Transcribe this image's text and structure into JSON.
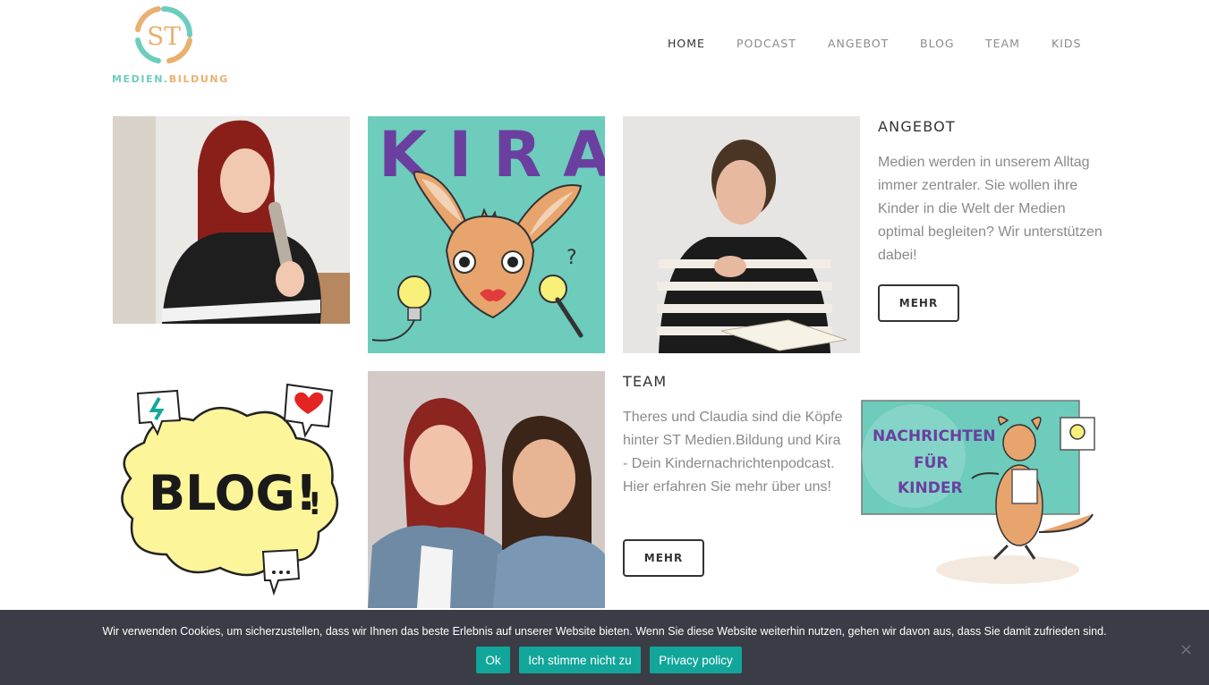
{
  "logo": {
    "monogram": "ST",
    "brand_part1": "MEDIEN.",
    "brand_part2": "BILDUNG",
    "colors": {
      "teal": "#6ccdbd",
      "orange": "#e9b06f"
    }
  },
  "nav": {
    "items": [
      {
        "label": "HOME",
        "active": true
      },
      {
        "label": "PODCAST",
        "active": false
      },
      {
        "label": "ANGEBOT",
        "active": false
      },
      {
        "label": "BLOG",
        "active": false
      },
      {
        "label": "TEAM",
        "active": false
      },
      {
        "label": "KIDS",
        "active": false
      }
    ]
  },
  "tiles": {
    "kira_title": "KIRA",
    "blog_text": "BLOG!",
    "blog_exclaim": "!",
    "kids_line1": "NACHRICHTEN",
    "kids_line2": "FÜR",
    "kids_line3": "KINDER"
  },
  "angebot": {
    "heading": "ANGEBOT",
    "text": "Medien werden in unserem Alltag immer zentraler. Sie wollen ihre Kinder in die Welt der Medien optimal begleiten? Wir unterstützen dabei!",
    "button": "MEHR"
  },
  "team": {
    "heading": "TEAM",
    "text": "Theres und Claudia sind die Köpfe hinter ST Medien.Bildung und Kira - Dein Kindernachrichtenpodcast. Hier erfahren Sie mehr über uns!",
    "button": "MEHR"
  },
  "cookie": {
    "message": "Wir verwenden Cookies, um sicherzustellen, dass wir Ihnen das beste Erlebnis auf unserer Website bieten. Wenn Sie diese Website weiterhin nutzen, gehen wir davon aus, dass Sie damit zufrieden sind.",
    "ok": "Ok",
    "decline": "Ich stimme nicht zu",
    "privacy": "Privacy policy",
    "close": "×"
  },
  "colors": {
    "accent_button": "#12a69a",
    "banner_bg": "#3a3d45",
    "kira_bg": "#6dccbc",
    "kira_title": "#6b3fa0"
  }
}
